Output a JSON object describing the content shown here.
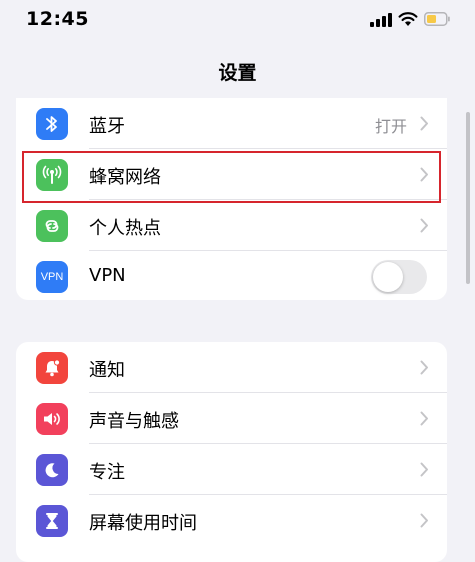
{
  "status_bar": {
    "time": "12:45"
  },
  "nav": {
    "title": "设置"
  },
  "colors": {
    "bluetooth": "#2f7cf6",
    "cellular": "#4cc15c",
    "hotspot": "#4cc15c",
    "vpn": "#2f7cf6",
    "notifications": "#f2453d",
    "sounds": "#f2405c",
    "focus": "#5b56d6",
    "screen_time": "#5b56d6",
    "highlight": "#d6252d",
    "battery": "#f7c948"
  },
  "group1": [
    {
      "icon": "bluetooth-icon",
      "label": "蓝牙",
      "value": "打开"
    },
    {
      "icon": "cellular-antenna-icon",
      "label": "蜂窝网络"
    },
    {
      "icon": "personal-hotspot-icon",
      "label": "个人热点"
    },
    {
      "icon": "vpn-icon",
      "icon_text": "VPN",
      "label": "VPN",
      "toggle_on": false
    }
  ],
  "group2": [
    {
      "icon": "notifications-icon",
      "label": "通知"
    },
    {
      "icon": "sounds-icon",
      "label": "声音与触感"
    },
    {
      "icon": "focus-moon-icon",
      "label": "专注"
    },
    {
      "icon": "hourglass-icon",
      "label": "屏幕使用时间"
    }
  ]
}
